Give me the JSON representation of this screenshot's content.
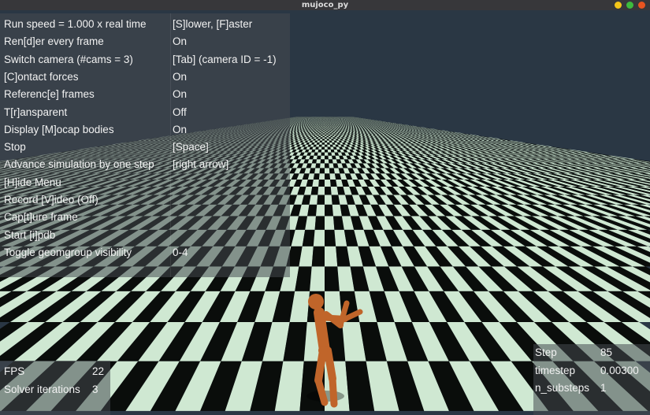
{
  "window": {
    "title": "mujoco_py",
    "colors": {
      "close": "#e95420",
      "minimize": "#f5c518",
      "maximize": "#3dbb3d"
    }
  },
  "menu": {
    "rows": [
      {
        "key": "Run speed = 1.000 x real time",
        "value": "[S]lower, [F]aster"
      },
      {
        "key": "Ren[d]er every frame",
        "value": "On"
      },
      {
        "key": "Switch camera (#cams = 3)",
        "value": "[Tab] (camera ID = -1)"
      },
      {
        "key": "[C]ontact forces",
        "value": "On"
      },
      {
        "key": "Referenc[e] frames",
        "value": "On"
      },
      {
        "key": "T[r]ansparent",
        "value": "Off"
      },
      {
        "key": "Display [M]ocap bodies",
        "value": "On"
      },
      {
        "key": "Stop",
        "value": "[Space]"
      },
      {
        "key": "Advance simulation by one step",
        "value": "[right arrow]"
      },
      {
        "key": "[H]ide Menu",
        "value": ""
      },
      {
        "key": "Record [V]ideo (Off)",
        "value": ""
      },
      {
        "key": "Cap[t]ure frame",
        "value": ""
      },
      {
        "key": "Start [i]pdb",
        "value": ""
      },
      {
        "key": "Toggle geomgroup visibility",
        "value": "0-4"
      }
    ]
  },
  "stats_left": {
    "rows": [
      {
        "key": "FPS",
        "value": "22"
      },
      {
        "key": "Solver iterations",
        "value": "3"
      }
    ]
  },
  "stats_right": {
    "rows": [
      {
        "key": "Step",
        "value": "85"
      },
      {
        "key": "timestep",
        "value": "0.00300"
      },
      {
        "key": "n_substeps",
        "value": "1"
      }
    ]
  },
  "scene": {
    "sky_color": "#2a3744",
    "floor_light_color": "#cfe8d2",
    "floor_dark_color": "#0a0d0b",
    "body_color": "#c0652a"
  }
}
